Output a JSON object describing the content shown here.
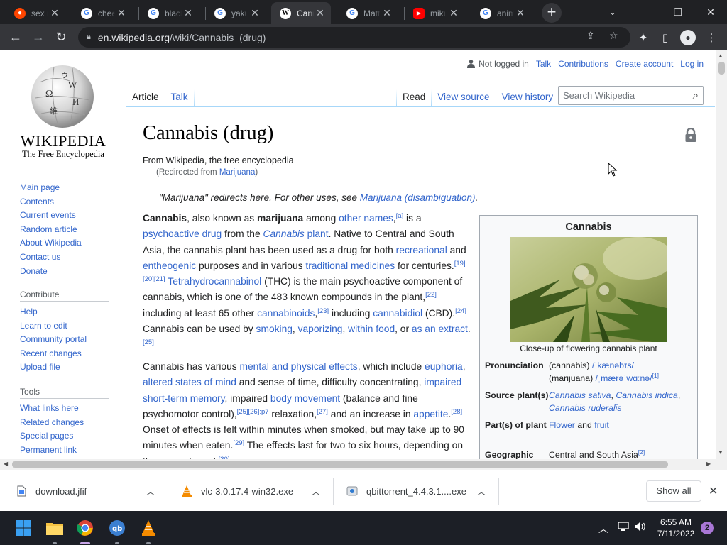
{
  "browser": {
    "tabs": [
      {
        "title": "sex n",
        "favicon": "reddit-icon",
        "color": "#ff4500"
      },
      {
        "title": "cheer",
        "favicon": "google-icon",
        "color": "#ffffff"
      },
      {
        "title": "black",
        "favicon": "google-icon",
        "color": "#ffffff"
      },
      {
        "title": "yakul",
        "favicon": "google-icon",
        "color": "#ffffff"
      },
      {
        "title": "Cann",
        "favicon": "wikipedia-icon",
        "color": "#ffffff"
      },
      {
        "title": "Matt",
        "favicon": "google-icon",
        "color": "#ffffff"
      },
      {
        "title": "miku",
        "favicon": "youtube-icon",
        "color": "#ff0000"
      },
      {
        "title": "anim",
        "favicon": "google-icon",
        "color": "#ffffff"
      }
    ],
    "url_host": "en.wikipedia.org",
    "url_path": "/wiki/Cannabis_(drug)"
  },
  "wiki": {
    "wordmark": "WIKIPEDIA",
    "tagline": "The Free Encyclopedia",
    "personal": {
      "not_logged_in": "Not logged in",
      "talk": "Talk",
      "contributions": "Contributions",
      "create_account": "Create account",
      "log_in": "Log in"
    },
    "tabs": {
      "article": "Article",
      "talk": "Talk",
      "read": "Read",
      "view_source": "View source",
      "view_history": "View history"
    },
    "search_placeholder": "Search Wikipedia",
    "nav": [
      "Main page",
      "Contents",
      "Current events",
      "Random article",
      "About Wikipedia",
      "Contact us",
      "Donate"
    ],
    "contribute_heading": "Contribute",
    "contribute": [
      "Help",
      "Learn to edit",
      "Community portal",
      "Recent changes",
      "Upload file"
    ],
    "tools_heading": "Tools",
    "tools": [
      "What links here",
      "Related changes",
      "Special pages",
      "Permanent link"
    ]
  },
  "article": {
    "title": "Cannabis (drug)",
    "from": "From Wikipedia, the free encyclopedia",
    "redirected_prefix": "(Redirected from ",
    "redirected_link": "Marijuana",
    "redirected_suffix": ")",
    "hatnote_prefix": "\"Marijuana\" redirects here. For other uses, see ",
    "hatnote_link": "Marijuana (disambiguation)",
    "hatnote_suffix": "."
  },
  "infobox": {
    "title": "Cannabis",
    "caption": "Close-up of flowering cannabis plant",
    "rows": [
      {
        "key": "Pronunciation"
      },
      {
        "key": "Source plant(s)"
      },
      {
        "key": "Part(s) of plant"
      },
      {
        "key": "Geographic"
      }
    ]
  },
  "downloads": [
    {
      "name": "download.jfif"
    },
    {
      "name": "vlc-3.0.17.4-win32.exe"
    },
    {
      "name": "qbittorrent_4.4.3.1....exe"
    }
  ],
  "downloads_show_all": "Show all",
  "taskbar": {
    "time": "6:55 AM",
    "date": "7/11/2022",
    "notifications": "2"
  }
}
